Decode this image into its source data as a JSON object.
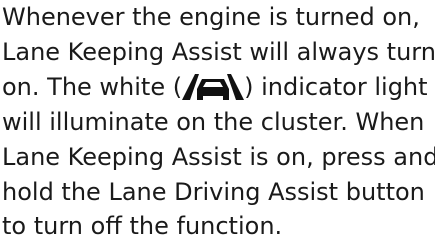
{
  "paragraph": {
    "line1": "Whenever the engine is turned on,",
    "line2": "Lane Keeping Assist will always turn",
    "line3_before": "on. The white (",
    "line3_after": ") indicator light",
    "line4": "will illuminate on the cluster. When",
    "line5": "Lane Keeping Assist is on, press and",
    "line6": "hold the Lane Driving Assist button",
    "line7": "to turn off the function."
  },
  "icon": {
    "name": "lane-keeping-assist-icon",
    "color": "#111111"
  }
}
